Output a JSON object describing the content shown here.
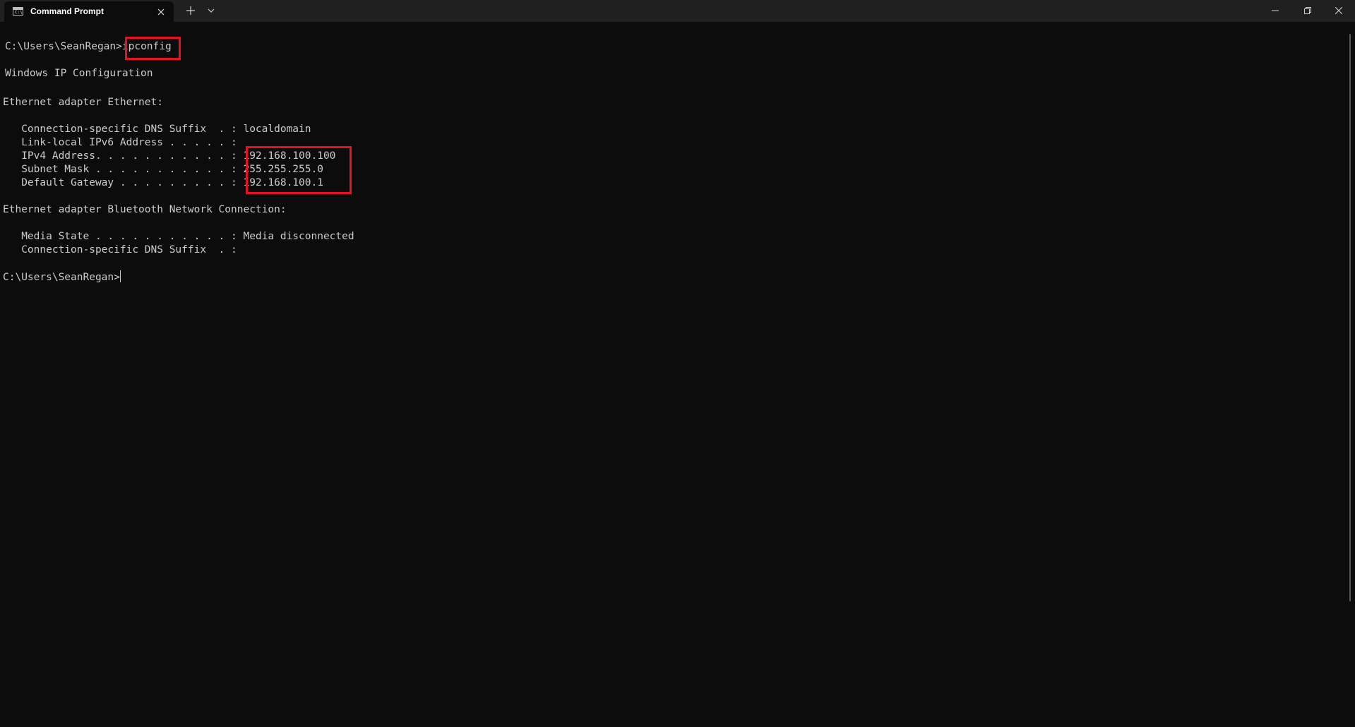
{
  "window": {
    "tab_title": "Command Prompt",
    "tab_icon": "terminal-icon",
    "controls": [
      "close-icon",
      "plus-icon",
      "chevron-down-icon",
      "minimize-icon",
      "restore-icon",
      "close-icon"
    ]
  },
  "terminal": {
    "prompt1": "C:\\Users\\SeanRegan>",
    "command": "ipconfig",
    "heading": "Windows IP Configuration",
    "adapter1_title": "Ethernet adapter Ethernet:",
    "adapter1": [
      {
        "label": "   Connection-specific DNS Suffix  . : ",
        "value": "localdomain"
      },
      {
        "label": "   Link-local IPv6 Address . . . . . : ",
        "value": ""
      },
      {
        "label": "   IPv4 Address. . . . . . . . . . . : ",
        "value": "192.168.100.100"
      },
      {
        "label": "   Subnet Mask . . . . . . . . . . . : ",
        "value": "255.255.255.0"
      },
      {
        "label": "   Default Gateway . . . . . . . . . : ",
        "value": "192.168.100.1"
      }
    ],
    "adapter2_title": "Ethernet adapter Bluetooth Network Connection:",
    "adapter2": [
      {
        "label": "   Media State . . . . . . . . . . . : ",
        "value": "Media disconnected"
      },
      {
        "label": "   Connection-specific DNS Suffix  . : ",
        "value": ""
      }
    ],
    "prompt2": "C:\\Users\\SeanRegan>"
  },
  "colors": {
    "background": "#0c0c0c",
    "titlebar": "#202020",
    "text": "#cccccc",
    "highlight": "#e81123"
  }
}
